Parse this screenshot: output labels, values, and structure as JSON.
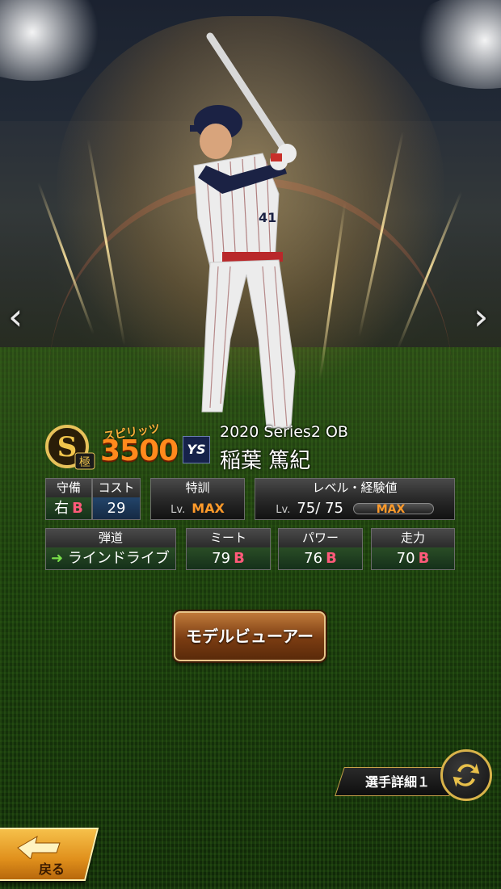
{
  "player": {
    "rank_letter": "S",
    "rank_sub": "極",
    "spirit_label": "スピリッツ",
    "spirit_value": "3500",
    "team_logo": "YS",
    "series": "2020 Series2 OB",
    "name": "稲葉 篤紀",
    "uniform_number": "41"
  },
  "stats": {
    "defense": {
      "header": "守備",
      "position": "右",
      "grade": "B"
    },
    "cost": {
      "header": "コスト",
      "value": "29"
    },
    "training": {
      "header": "特訓",
      "lv_label": "Lv.",
      "value": "MAX"
    },
    "level": {
      "header": "レベル・経験値",
      "lv_label": "Lv.",
      "current": "75",
      "sep": "/",
      "max": "75",
      "bar_label": "MAX"
    },
    "trajectory": {
      "header": "弾道",
      "value": "ラインドライブ"
    },
    "meet": {
      "header": "ミート",
      "value": "79",
      "grade": "B"
    },
    "power": {
      "header": "パワー",
      "value": "76",
      "grade": "B"
    },
    "speed": {
      "header": "走力",
      "value": "70",
      "grade": "B"
    }
  },
  "buttons": {
    "model_viewer": "モデルビューアー",
    "detail_tab": "選手詳細１",
    "back": "戻る"
  },
  "nav": {
    "prev": "‹",
    "next": "›"
  },
  "colors": {
    "grade": "#ff5a7a",
    "max": "#ff9a2a",
    "spirit": "#ff8a1c",
    "stat_bg": "#1f4a1f"
  }
}
